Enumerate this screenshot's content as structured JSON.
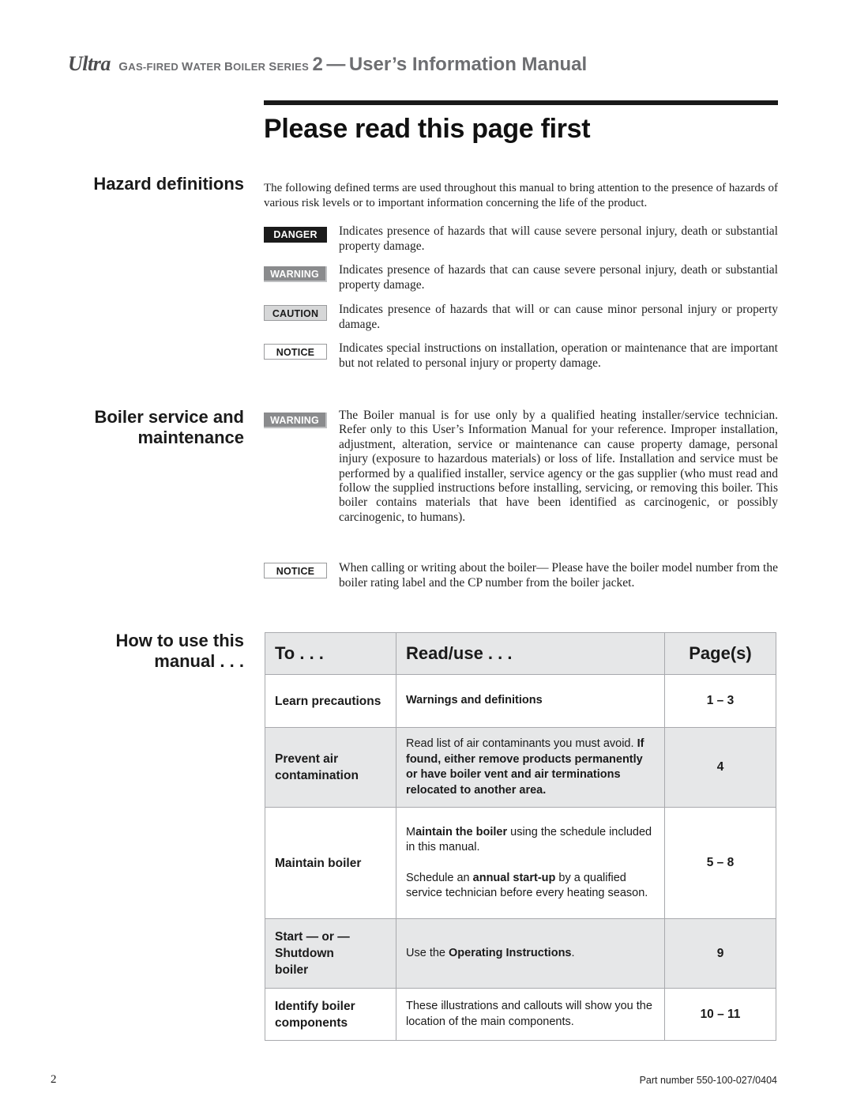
{
  "header": {
    "brand": "Ultra",
    "series_prefix_cap1": "G",
    "series_prefix_rest1": "AS-FIRED ",
    "series_cap2": "W",
    "series_rest2": "ATER ",
    "series_cap3": "B",
    "series_rest3": "OILER ",
    "series_cap4": "S",
    "series_rest4": "ERIES",
    "series_number": "2",
    "dash": "—",
    "manual_title": "User’s Information Manual"
  },
  "page_title": "Please read this page first",
  "sections": {
    "hazard": {
      "heading": "Hazard definitions",
      "intro": "The following defined terms are used throughout this manual to bring attention to the presence of hazards of various risk levels or to important information concerning the life of the product.",
      "items": [
        {
          "badge": "DANGER",
          "text": "Indicates presence of hazards that will cause severe personal injury, death or substantial property damage."
        },
        {
          "badge": "WARNING",
          "text": "Indicates presence of hazards that can cause severe personal injury, death or substantial property damage."
        },
        {
          "badge": "CAUTION",
          "text": "Indicates presence of hazards that will or can cause minor personal injury or property damage."
        },
        {
          "badge": "NOTICE",
          "text": "Indicates special instructions on installation, operation or maintenance that are important but not related to personal injury or property damage."
        }
      ]
    },
    "service": {
      "heading_line1": "Boiler service and",
      "heading_line2": "maintenance",
      "warning_badge": "WARNING",
      "warning_text": "The Boiler manual is for use only by a qualified heating installer/service technician. Refer only to this User’s Information Manual for your reference. Improper installation, adjustment, alteration, service or maintenance can cause property damage, personal injury (exposure to hazardous materials) or loss of life. Installation and service must be performed by a qualified installer, service agency or the gas supplier (who must read and follow the supplied instructions before installing, servicing, or removing this boiler. This boiler contains materials that have been identified as carcinogenic, or possibly carcinogenic, to humans).",
      "notice_badge": "NOTICE",
      "notice_text": "When calling or writing about the boiler— Please have the boiler model number from the boiler rating label and the CP number from the boiler jacket."
    },
    "howto": {
      "heading_line1": "How to use this",
      "heading_line2": "manual . . .",
      "columns": [
        "To . . .",
        "Read/use . . .",
        "Page(s)"
      ],
      "rows": [
        {
          "to": "Learn precautions",
          "read_bold": "Warnings and definitions",
          "pages": "1 – 3"
        },
        {
          "to": "Prevent air contamination",
          "read_plain": "Read list of air contaminants you must avoid.",
          "read_bold": "If found, either remove products permanently or have boiler vent and air terminations relocated to another area.",
          "pages": "4"
        },
        {
          "to": "Maintain boiler",
          "read_a_pre": "M",
          "read_a_bold": "aintain the boiler",
          "read_a_post": " using the schedule included in this manual.",
          "read_b_pre": "Schedule an ",
          "read_b_bold": "annual start-up",
          "read_b_post": " by a qualified service technician before every heating season.",
          "pages": "5 – 8"
        },
        {
          "to_line1": "Start — or —",
          "to_line2": "Shutdown",
          "to_line3": "boiler",
          "read_pre": "Use the ",
          "read_bold": "Operating Instructions",
          "read_post": ".",
          "pages": "9"
        },
        {
          "to": "Identify boiler components",
          "read_plain": "These illustrations and callouts will show you the location of the main components.",
          "pages": "10 – 11"
        }
      ]
    }
  },
  "footer": {
    "page_number": "2",
    "part_number": "Part number 550-100-027/0404"
  }
}
